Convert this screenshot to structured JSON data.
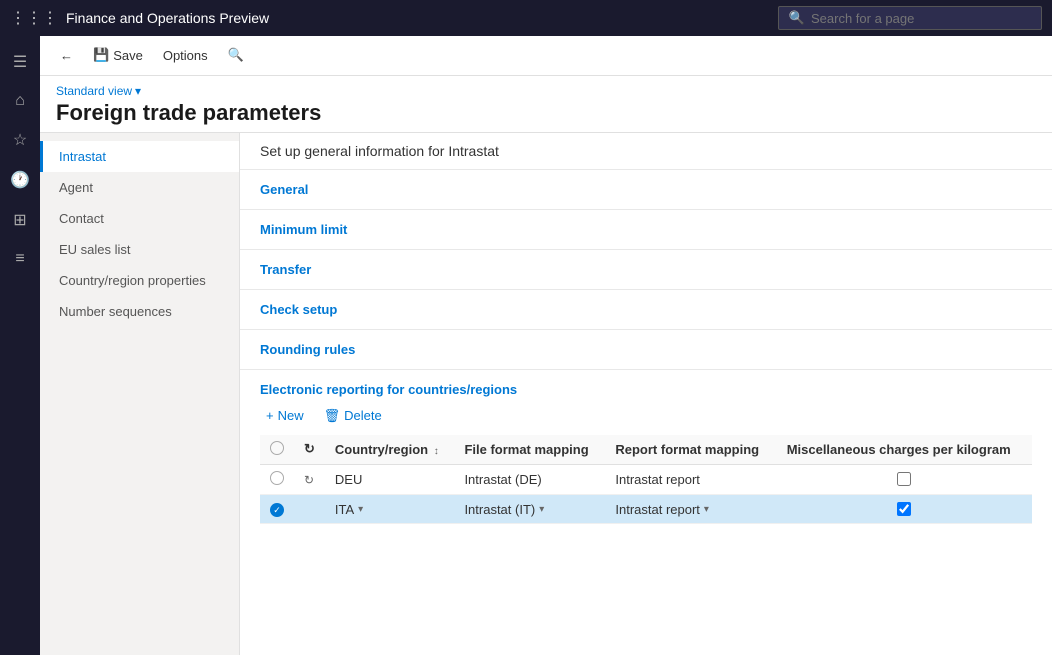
{
  "topBar": {
    "appTitle": "Finance and Operations Preview",
    "searchPlaceholder": "Search for a page"
  },
  "toolbar": {
    "backLabel": "Back",
    "saveLabel": "Save",
    "optionsLabel": "Options",
    "searchLabel": "Search"
  },
  "pageHeader": {
    "viewLabel": "Standard view",
    "title": "Foreign trade parameters"
  },
  "nav": {
    "items": [
      {
        "id": "intrastat",
        "label": "Intrastat",
        "active": true
      },
      {
        "id": "agent",
        "label": "Agent",
        "active": false
      },
      {
        "id": "contact",
        "label": "Contact",
        "active": false
      },
      {
        "id": "eu-sales-list",
        "label": "EU sales list",
        "active": false
      },
      {
        "id": "country-region",
        "label": "Country/region properties",
        "active": false
      },
      {
        "id": "number-sequences",
        "label": "Number sequences",
        "active": false
      }
    ]
  },
  "content": {
    "sectionTitle": "Set up general information for Intrastat",
    "sections": [
      {
        "id": "general",
        "label": "General"
      },
      {
        "id": "minimum-limit",
        "label": "Minimum limit"
      },
      {
        "id": "transfer",
        "label": "Transfer"
      },
      {
        "id": "check-setup",
        "label": "Check setup"
      },
      {
        "id": "rounding-rules",
        "label": "Rounding rules"
      }
    ],
    "electronicReporting": {
      "title": "Electronic reporting for countries/regions",
      "newLabel": "New",
      "deleteLabel": "Delete",
      "table": {
        "columns": [
          {
            "id": "country",
            "label": "Country/region"
          },
          {
            "id": "file-format",
            "label": "File format mapping"
          },
          {
            "id": "report-format",
            "label": "Report format mapping"
          },
          {
            "id": "misc-charges",
            "label": "Miscellaneous charges per kilogram"
          }
        ],
        "rows": [
          {
            "id": "row1",
            "selected": false,
            "checked": false,
            "country": "DEU",
            "fileFormat": "Intrastat (DE)",
            "reportFormat": "Intrastat report",
            "miscCharges": false
          },
          {
            "id": "row2",
            "selected": true,
            "checked": true,
            "country": "ITA",
            "fileFormat": "Intrastat (IT)",
            "reportFormat": "Intrastat report",
            "miscCharges": true
          }
        ]
      }
    }
  },
  "sideIcons": [
    {
      "id": "hamburger",
      "icon": "☰"
    },
    {
      "id": "home",
      "icon": "⌂"
    },
    {
      "id": "star",
      "icon": "☆"
    },
    {
      "id": "recent",
      "icon": "○"
    },
    {
      "id": "workspace",
      "icon": "⊞"
    },
    {
      "id": "list",
      "icon": "≡"
    }
  ]
}
